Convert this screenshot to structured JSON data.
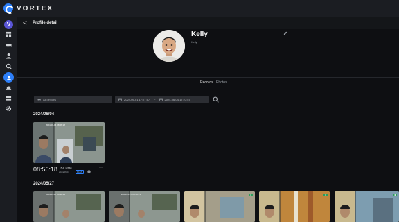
{
  "app": {
    "brand": "VORTEX",
    "user_initial": "V"
  },
  "header": {
    "back_glyph": "<",
    "title": "Profile detail"
  },
  "sidebar": {
    "items": [
      {
        "name": "dashboard-icon"
      },
      {
        "name": "camera-icon"
      },
      {
        "name": "person-icon"
      },
      {
        "name": "face-search-icon"
      },
      {
        "name": "profile-icon",
        "active": true
      },
      {
        "name": "alert-icon"
      },
      {
        "name": "storage-icon"
      },
      {
        "name": "settings-icon"
      }
    ]
  },
  "profile": {
    "name": "Kelly",
    "subtitle": "Kelly"
  },
  "tabs": [
    {
      "label": "Records",
      "active": true
    },
    {
      "label": "Photos",
      "active": false
    }
  ],
  "filters": {
    "devices_label": "All devices",
    "start": "2024-05-01  17:27:57",
    "separator": "~",
    "end": "2024-06-04  17:27:57"
  },
  "groups": [
    {
      "date": "2024/06/04",
      "records": [
        {
          "time": "08:56:18",
          "device": "TK3_Desk",
          "date": "2024/06/04",
          "badge": "PASS",
          "cam_timestamp": "2024-06-04 08:56:18"
        }
      ]
    },
    {
      "date": "2024/05/27",
      "records": [
        {
          "cam_timestamp": "2024-05-27 14:49:51"
        },
        {
          "cam_timestamp": "2024-05-27 14:49:51"
        }
      ]
    }
  ],
  "colors": {
    "accent": "#2d7ff9",
    "background": "#0e0f12",
    "panel": "#1b1d22"
  }
}
